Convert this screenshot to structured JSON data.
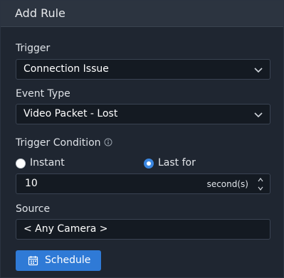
{
  "dialog": {
    "title": "Add Rule"
  },
  "trigger": {
    "label": "Trigger",
    "value": "Connection Issue",
    "chevron_icon": "chevron-down-icon"
  },
  "event_type": {
    "label": "Event Type",
    "value": "Video Packet - Lost",
    "chevron_icon": "chevron-down-icon"
  },
  "trigger_condition": {
    "label": "Trigger Condition",
    "info_icon": "info-icon",
    "options": [
      {
        "label": "Instant",
        "selected": false
      },
      {
        "label": "Last for",
        "selected": true
      }
    ],
    "duration_value": "10",
    "duration_unit": "second(s)"
  },
  "source": {
    "label": "Source",
    "value": "< Any Camera >"
  },
  "schedule_button": {
    "label": "Schedule",
    "icon": "calendar-icon"
  },
  "colors": {
    "accent": "#2f7ad6",
    "background": "#1f2631",
    "header": "#2c3440",
    "field": "#141a22"
  }
}
